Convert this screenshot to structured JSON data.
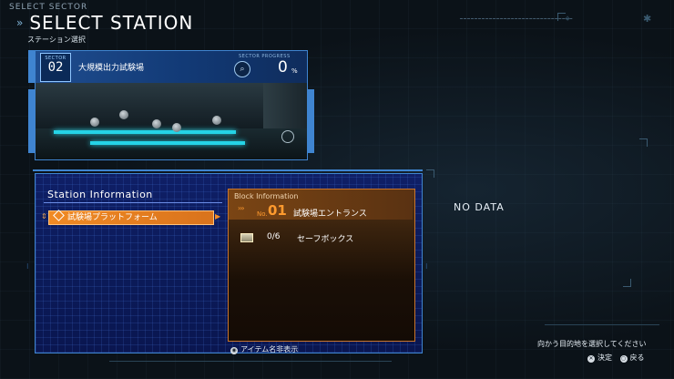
{
  "header": {
    "sub_title": "SELECT SECTOR",
    "title": "SELECT STATION",
    "title_jp": "ステーション選択"
  },
  "sector": {
    "label": "SECTOR",
    "number": "02",
    "name": "大規模出力試験場",
    "progress_label": "SECTOR PROGRESS",
    "progress_value": "0",
    "progress_unit": "%"
  },
  "station_panel": {
    "title": "Station Information",
    "items": [
      {
        "label": "試験場プラットフォーム",
        "selected": true
      }
    ]
  },
  "block": {
    "label": "Block Information",
    "no_prefix": "No.",
    "number": "01",
    "name": "試験場エントランス",
    "items": [
      {
        "icon": "safe-box-icon",
        "count": "0/6",
        "name": "セーフボックス"
      }
    ]
  },
  "right_panel": {
    "no_data": "NO DATA"
  },
  "footer": {
    "hide_names": "アイテム名非表示",
    "guide": "向かう目的地を選択してください",
    "confirm": "決定",
    "back": "戻る"
  },
  "colors": {
    "accent_blue": "#3f84d0",
    "accent_orange": "#f08a24",
    "panel_blue": "#0f1f66"
  }
}
